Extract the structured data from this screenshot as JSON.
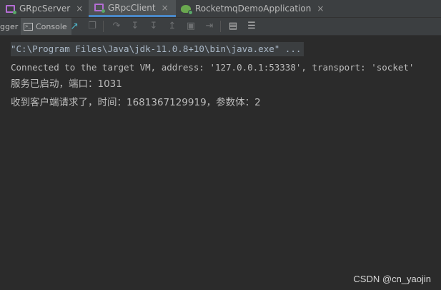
{
  "tabs": [
    {
      "label": "GRpcServer",
      "close": "×"
    },
    {
      "label": "GRpcClient",
      "close": "×"
    },
    {
      "label": "RocketmqDemoApplication",
      "close": "×"
    }
  ],
  "toolbar": {
    "debugger_label": "gger",
    "console_label": "Console",
    "console_icon_glyph": ">_",
    "icons": [
      "restore-layout-icon",
      "step-over-icon",
      "step-into-icon",
      "force-step-into-icon",
      "step-out-icon",
      "drop-frame-icon",
      "run-to-cursor-icon",
      "evaluate-expression-icon",
      "trace-settings-icon"
    ]
  },
  "console": {
    "lines": [
      "\"C:\\Program Files\\Java\\jdk-11.0.8+10\\bin\\java.exe\" ...",
      "Connected to the target VM, address: '127.0.0.1:53338', transport: 'socket'",
      "服务已启动，端口：1031",
      "收到客户端请求了，时间：1681367129919，参数体：2"
    ]
  },
  "watermark": "CSDN @cn_yaojin",
  "colors": {
    "background": "#2b2b2b",
    "toolbar": "#3c3f41",
    "active_tab_underline": "#4a88c7",
    "text": "#bbbbbb"
  }
}
